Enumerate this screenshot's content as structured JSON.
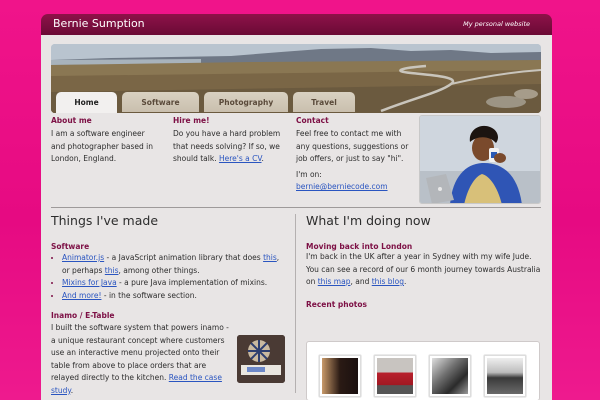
{
  "header": {
    "site_title": "Bernie Sumption",
    "tagline": "My personal website"
  },
  "tabs": [
    {
      "label": "Home",
      "active": true
    },
    {
      "label": "Software",
      "active": false
    },
    {
      "label": "Photography",
      "active": false
    },
    {
      "label": "Travel",
      "active": false
    }
  ],
  "about": {
    "heading": "About me",
    "body": "I am a software engineer and photographer based in London, England."
  },
  "hire": {
    "heading": "Hire me!",
    "body": "Do you have a hard problem that needs solving? If so, we should talk.",
    "link": "Here's a CV"
  },
  "contact": {
    "heading": "Contact",
    "body": "Feel free to contact me with any questions, suggestions or job offers, or just to say \"hi\".",
    "im_on_prefix": "I'm on:",
    "email": "bernie@berniecode.com"
  },
  "things": {
    "title": "Things I've made",
    "software_heading": "Software",
    "items": [
      {
        "link": "Animator.js",
        "text": " - a JavaScript animation library that does ",
        "link2": "this",
        "text2": ", or perhaps ",
        "link3": "this",
        "text3": ", among other things."
      },
      {
        "link": "Mixins for Java",
        "text": " - a pure Java implementation of mixins."
      },
      {
        "link": "And more!",
        "text": " - in the software section."
      }
    ],
    "inamo_heading": "Inamo / E-Table",
    "inamo_body": "I built the software system that powers inamo - a unique restaurant concept where customers use an interactive menu projected onto their table from above to place orders that are relayed directly to the kitchen.",
    "inamo_link": "Read the case study"
  },
  "doing": {
    "title": "What I'm doing now",
    "news_heading": "Moving back into London",
    "news_body_1": "I'm back in the UK after a year in Sydney with my wife Jude. You can see a record of our 6 month journey towards Australia on ",
    "news_link_1": "this map",
    "news_body_2": ", and ",
    "news_link_2": "this blog",
    "news_body_3": ".",
    "photos_heading": "Recent photos"
  },
  "colors": {
    "background": "#ee1a8e",
    "header_bar": "#7a0d3e",
    "heading_accent": "#7d1045",
    "link": "#2a55c0"
  }
}
